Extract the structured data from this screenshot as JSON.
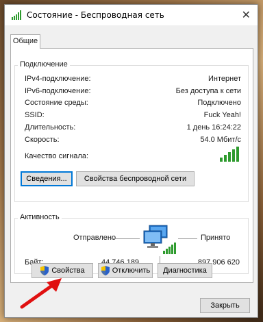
{
  "window": {
    "title": "Состояние - Беспроводная сеть",
    "close_glyph": "✕"
  },
  "tabs": [
    {
      "label": "Общие"
    }
  ],
  "connection": {
    "group_title": "Подключение",
    "rows": [
      {
        "label": "IPv4-подключение:",
        "value": "Интернет"
      },
      {
        "label": "IPv6-подключение:",
        "value": "Без доступа к сети"
      },
      {
        "label": "Состояние среды:",
        "value": "Подключено"
      },
      {
        "label": "SSID:",
        "value": "Fuck Yeah!"
      },
      {
        "label": "Длительность:",
        "value": "1 день 16:24:22"
      },
      {
        "label": "Скорость:",
        "value": "54.0 Мбит/с"
      }
    ],
    "signal_label": "Качество сигнала:",
    "details_button": "Сведения...",
    "wireless_props_button": "Свойства беспроводной сети"
  },
  "activity": {
    "group_title": "Активность",
    "sent_label": "Отправлено",
    "received_label": "Принято",
    "bytes_label": "Байт:",
    "bytes_sent": "44 746 189",
    "bytes_received": "897 906 620"
  },
  "buttons": {
    "properties": "Свойства",
    "disable": "Отключить",
    "diagnose": "Диагностика",
    "close": "Закрыть"
  },
  "icons": {
    "title": "signal-bars-icon",
    "signal": "signal-strength-icon",
    "network": "network-computers-icon",
    "shield": "uac-shield-icon",
    "arrow": "red-arrow-annotation"
  },
  "colors": {
    "signal_green": "#2e9b2e",
    "focus_blue": "#0078d7",
    "annotation_red": "#e01010"
  }
}
